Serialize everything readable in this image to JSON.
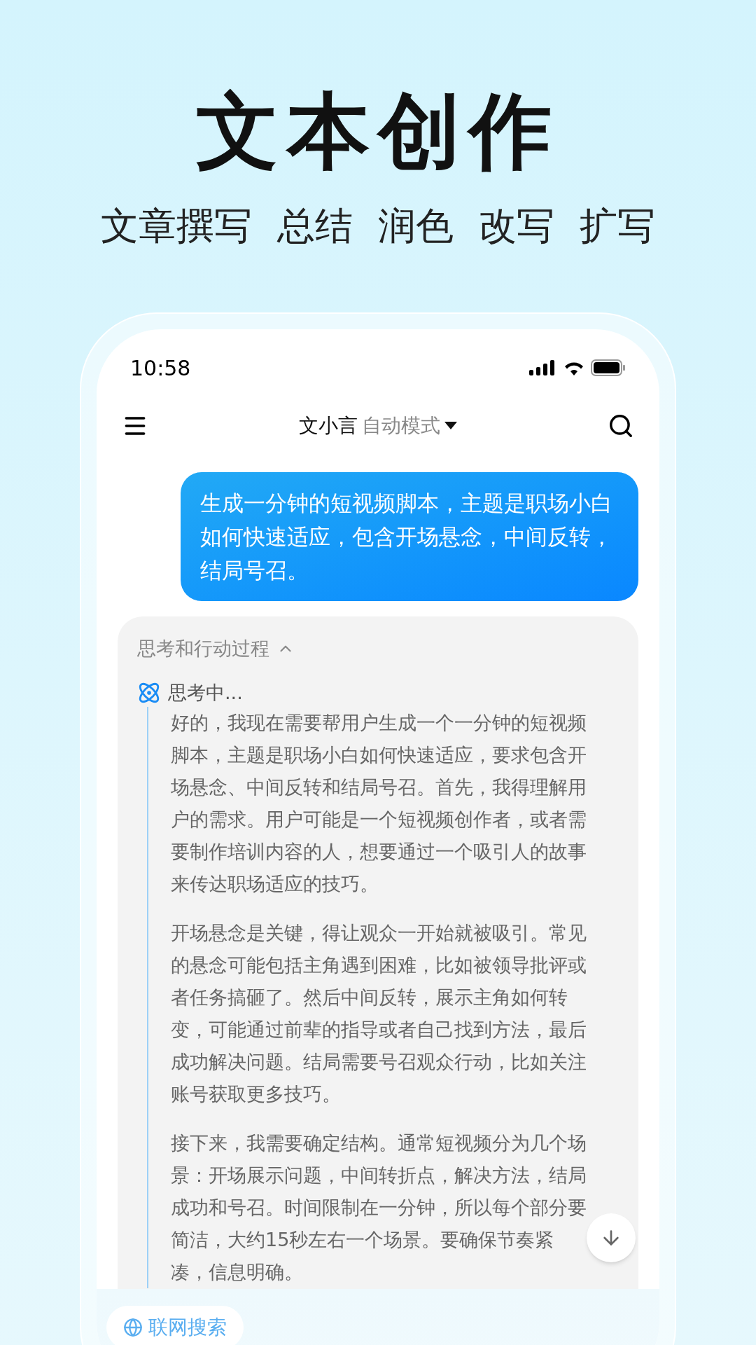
{
  "headline": "文本创作",
  "features": [
    "文章撰写",
    "总结",
    "润色",
    "改写",
    "扩写"
  ],
  "status_bar": {
    "time": "10:58"
  },
  "nav": {
    "title": "文小言",
    "mode": "自动模式"
  },
  "user_message": "生成一分钟的短视频脚本，主题是职场小白如何快速适应，包含开场悬念，中间反转，结局号召。",
  "thinking": {
    "header": "思考和行动过程",
    "expanded": true,
    "status": "思考中...",
    "paragraphs": [
      "好的，我现在需要帮用户生成一个一分钟的短视频脚本，主题是职场小白如何快速适应，要求包含开场悬念、中间反转和结局号召。首先，我得理解用户的需求。用户可能是一个短视频创作者，或者需要制作培训内容的人，想要通过一个吸引人的故事来传达职场适应的技巧。",
      "开场悬念是关键，得让观众一开始就被吸引。常见的悬念可能包括主角遇到困难，比如被领导批评或者任务搞砸了。然后中间反转，展示主角如何转变，可能通过前辈的指导或者自己找到方法，最后成功解决问题。结局需要号召观众行动，比如关注账号获取更多技巧。",
      "接下来，我需要确定结构。通常短视频分为几个场景：开场展示问题，中间转折点，解决方法，结局成功和号召。时间限制在一分钟，所以每个部分要简洁，大约15秒左右一个场景。要确保节奏紧凑，信息明确。"
    ]
  },
  "chips": [
    {
      "label": "联网搜索"
    }
  ]
}
